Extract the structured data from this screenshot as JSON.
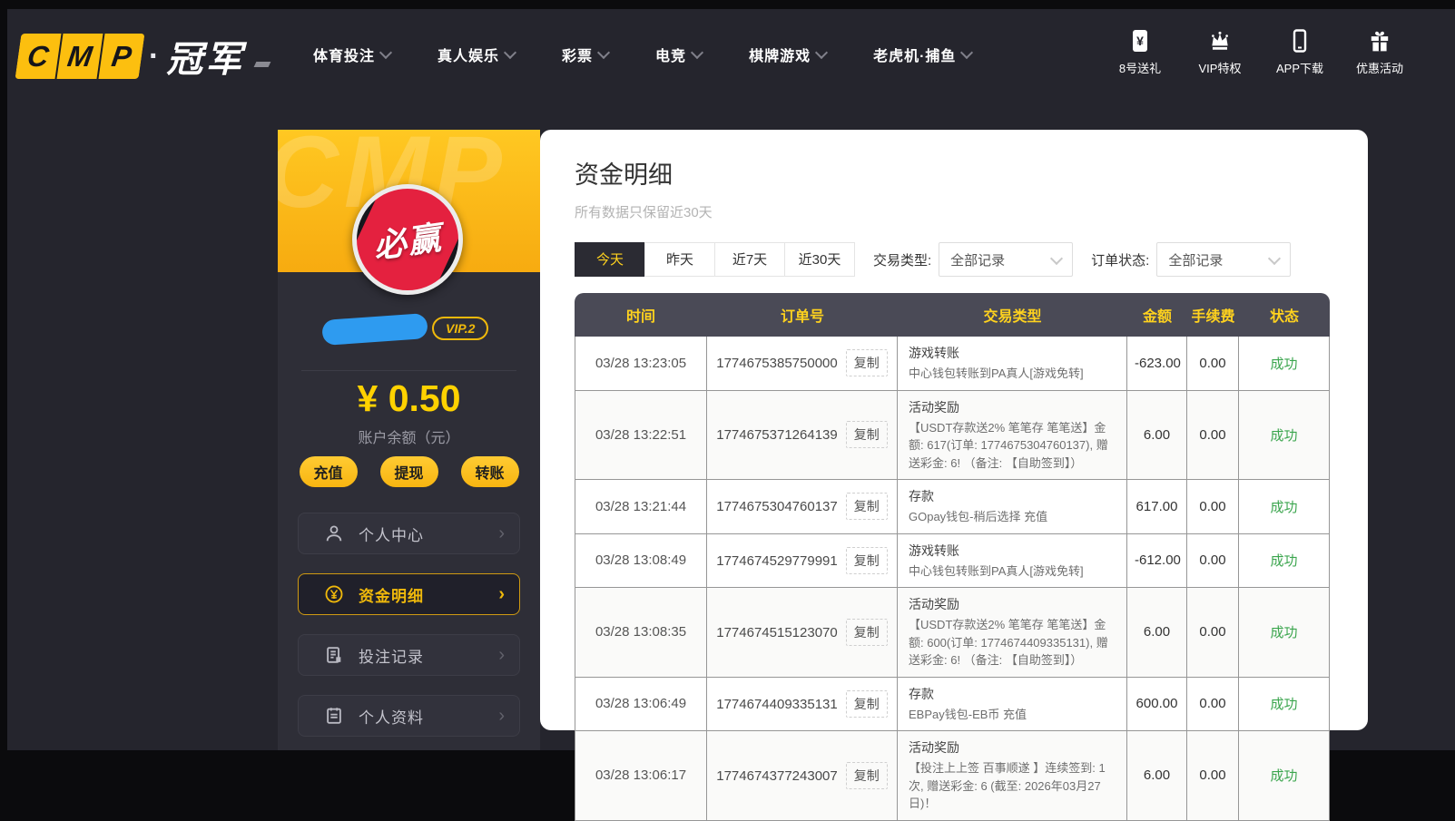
{
  "nav": {
    "logo": {
      "letters": [
        "C",
        "M",
        "P"
      ],
      "separator": "·",
      "brand": "冠军"
    },
    "items": [
      {
        "label": "体育投注"
      },
      {
        "label": "真人娱乐"
      },
      {
        "label": "彩票"
      },
      {
        "label": "电竞"
      },
      {
        "label": "棋牌游戏"
      },
      {
        "label": "老虎机·捕鱼"
      }
    ],
    "quick_links": [
      {
        "label": "8号送礼",
        "icon": "voucher-icon"
      },
      {
        "label": "VIP特权",
        "icon": "crown-icon"
      },
      {
        "label": "APP下载",
        "icon": "phone-icon"
      },
      {
        "label": "优惠活动",
        "icon": "gift-icon"
      }
    ]
  },
  "sidebar": {
    "avatar_text": "必赢",
    "vip_badge": "VIP.2",
    "balance": "¥ 0.50",
    "balance_label": "账户余额（元）",
    "actions": [
      {
        "label": "充值"
      },
      {
        "label": "提现"
      },
      {
        "label": "转账"
      }
    ],
    "menu": [
      {
        "label": "个人中心",
        "icon": "user-icon",
        "active": false
      },
      {
        "label": "资金明细",
        "icon": "yen-circle-icon",
        "active": true
      },
      {
        "label": "投注记录",
        "icon": "bet-record-icon",
        "active": false
      },
      {
        "label": "个人资料",
        "icon": "profile-icon",
        "active": false
      }
    ]
  },
  "main": {
    "title": "资金明细",
    "subtitle": "所有数据只保留近30天",
    "date_tabs": [
      {
        "label": "今天",
        "active": true
      },
      {
        "label": "昨天",
        "active": false
      },
      {
        "label": "近7天",
        "active": false
      },
      {
        "label": "近30天",
        "active": false
      }
    ],
    "filters": [
      {
        "label": "交易类型:",
        "value": "全部记录"
      },
      {
        "label": "订单状态:",
        "value": "全部记录"
      }
    ],
    "table": {
      "headers": [
        "时间",
        "订单号",
        "交易类型",
        "金额",
        "手续费",
        "状态"
      ],
      "copy_label": "复制",
      "rows": [
        {
          "time": "03/28 13:23:05",
          "order": "1774675385750000",
          "type_title": "游戏转账",
          "type_desc": "中心钱包转账到PA真人[游戏免转]",
          "amount": "-623.00",
          "fee": "0.00",
          "status": "成功"
        },
        {
          "time": "03/28 13:22:51",
          "order": "1774675371264139",
          "type_title": "活动奖励",
          "type_desc": "【USDT存款送2% 笔笔存 笔笔送】金额: 617(订单: 1774675304760137), 赠送彩金: 6! （备注: 【自助签到】）",
          "amount": "6.00",
          "fee": "0.00",
          "status": "成功"
        },
        {
          "time": "03/28 13:21:44",
          "order": "1774675304760137",
          "type_title": "存款",
          "type_desc": "GOpay钱包-稍后选择 充值",
          "amount": "617.00",
          "fee": "0.00",
          "status": "成功"
        },
        {
          "time": "03/28 13:08:49",
          "order": "1774674529779991",
          "type_title": "游戏转账",
          "type_desc": "中心钱包转账到PA真人[游戏免转]",
          "amount": "-612.00",
          "fee": "0.00",
          "status": "成功"
        },
        {
          "time": "03/28 13:08:35",
          "order": "1774674515123070",
          "type_title": "活动奖励",
          "type_desc": "【USDT存款送2% 笔笔存 笔笔送】金额: 600(订单: 1774674409335131), 赠送彩金: 6! （备注: 【自助签到】）",
          "amount": "6.00",
          "fee": "0.00",
          "status": "成功"
        },
        {
          "time": "03/28 13:06:49",
          "order": "1774674409335131",
          "type_title": "存款",
          "type_desc": "EBPay钱包-EB币 充值",
          "amount": "600.00",
          "fee": "0.00",
          "status": "成功"
        },
        {
          "time": "03/28 13:06:17",
          "order": "1774674377243007",
          "type_title": "活动奖励",
          "type_desc": "【投注上上签 百事顺遂 】连续签到: 1次, 赠送彩金: 6 (截至: 2026年03月27日)！",
          "amount": "6.00",
          "fee": "0.00",
          "status": "成功"
        }
      ]
    }
  },
  "colors": {
    "brand_yellow": "#fcbf0f",
    "accent_yellow": "#f0b90b",
    "status_green": "#3aa54d",
    "username_mask_blue": "#2e9bf0",
    "table_header_bg": "#4a4a56",
    "page_bg": "#25252d"
  }
}
